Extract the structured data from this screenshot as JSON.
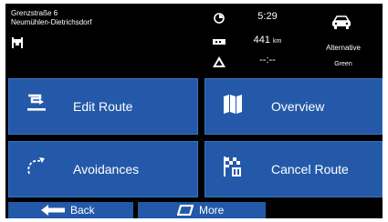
{
  "address": {
    "street": "Grenzstraße 6",
    "city": "Neumühlen-Dietrichsdorf",
    "icon": "destination-flag-icon"
  },
  "trip_stats": {
    "time": {
      "icon": "clock-icon",
      "value": "5:29"
    },
    "distance": {
      "icon": "distance-icon",
      "value": "441",
      "unit": "km"
    },
    "eta": {
      "icon": "warning-triangle-icon",
      "value": "--:--"
    }
  },
  "vehicle": {
    "icon": "car-icon",
    "route_type": "Alternative",
    "route_variant": "Green"
  },
  "menu": {
    "edit_route": {
      "label": "Edit Route",
      "icon": "edit-route-icon"
    },
    "overview": {
      "label": "Overview",
      "icon": "map-icon"
    },
    "avoidances": {
      "label": "Avoidances",
      "icon": "avoid-icon"
    },
    "cancel_route": {
      "label": "Cancel Route",
      "icon": "cancel-route-flag-icon"
    }
  },
  "bottom": {
    "back_label": "Back",
    "more_label": "More"
  },
  "colors": {
    "tile": "#2359a8",
    "background": "#000000",
    "text": "#ffffff"
  }
}
